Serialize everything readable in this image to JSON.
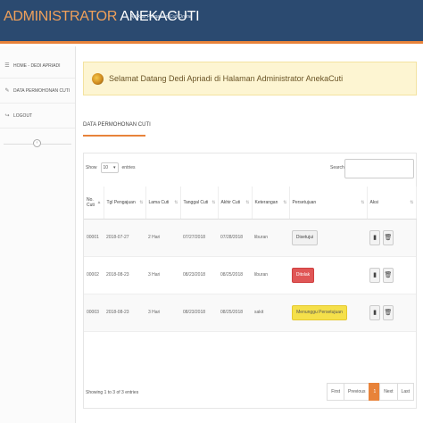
{
  "header": {
    "brand_part1": "ADMINISTRATOR",
    "brand_part2": "ANEKACUTI",
    "tagline": "Aplikasi Pengajuan Cuti Online"
  },
  "sidebar": {
    "items": [
      {
        "label": "HOME - DEDI APRIADI",
        "icon": "list-icon"
      },
      {
        "label": "DATA PERMOHONAN CUTI",
        "icon": "pencil-icon"
      },
      {
        "label": "LOGOUT",
        "icon": "logout-icon"
      }
    ],
    "slider_knob_glyph": "‹"
  },
  "welcome": {
    "text": "Selamat Datang Dedi Apriadi di Halaman Administrator AnekaCuti"
  },
  "section": {
    "title": "DATA PERMOHONAN CUTI"
  },
  "table_controls": {
    "show_label": "Show",
    "entries_value": "10",
    "entries_label": "entries",
    "search_label": "Search:"
  },
  "table": {
    "columns": [
      "No. Cuti",
      "Tgl Pengajuan",
      "Lama Cuti",
      "Tanggal Cuti",
      "Akhir Cuti",
      "Keterangan",
      "Persetujuan",
      "Aksi"
    ],
    "rows": [
      {
        "no": "00001",
        "tgl": "2018-07-27",
        "lama": "2 Hari",
        "tanggal": "07/27/2018",
        "akhir": "07/28/2018",
        "ket": "liburan",
        "status": "Disetujui",
        "status_type": "default"
      },
      {
        "no": "00002",
        "tgl": "2018-08-23",
        "lama": "3 Hari",
        "tanggal": "08/23/2018",
        "akhir": "08/25/2018",
        "ket": "liburan",
        "status": "Ditolak",
        "status_type": "danger"
      },
      {
        "no": "00003",
        "tgl": "2018-08-23",
        "lama": "3 Hari",
        "tanggal": "08/23/2018",
        "akhir": "08/25/2018",
        "ket": "sakit",
        "status": "Menunggu Persetujuan",
        "status_type": "warning"
      }
    ]
  },
  "footer": {
    "info": "Showing 1 to 3 of 3 entries",
    "pager": [
      "First",
      "Previous",
      "1",
      "Next",
      "Last"
    ],
    "active_page": "1"
  },
  "colors": {
    "header_bg": "#2b4a70",
    "accent": "#e8833a",
    "danger": "#e05656",
    "warning": "#f5e04a"
  }
}
